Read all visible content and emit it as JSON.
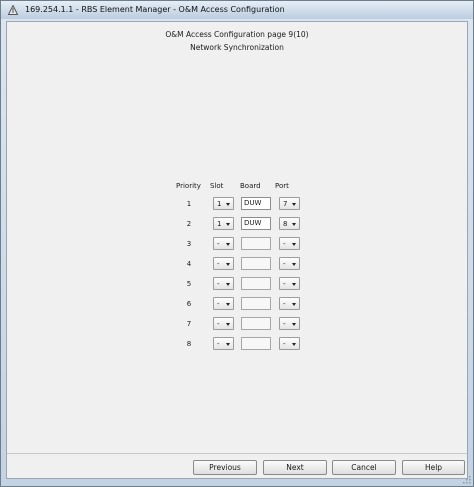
{
  "window": {
    "title": "169.254.1.1 - RBS Element Manager - O&M Access Configuration"
  },
  "page": {
    "heading": "O&M Access Configuration page 9(10)",
    "subheading": "Network Synchronization"
  },
  "table": {
    "headers": {
      "priority": "Priority",
      "slot": "Slot",
      "board": "Board",
      "port": "Port"
    },
    "rows": [
      {
        "priority": "1",
        "slot": "1",
        "board": "DUW",
        "port": "7"
      },
      {
        "priority": "2",
        "slot": "1",
        "board": "DUW",
        "port": "8"
      },
      {
        "priority": "3",
        "slot": "-",
        "board": "",
        "port": "-"
      },
      {
        "priority": "4",
        "slot": "-",
        "board": "",
        "port": "-"
      },
      {
        "priority": "5",
        "slot": "-",
        "board": "",
        "port": "-"
      },
      {
        "priority": "6",
        "slot": "-",
        "board": "",
        "port": "-"
      },
      {
        "priority": "7",
        "slot": "-",
        "board": "",
        "port": "-"
      },
      {
        "priority": "8",
        "slot": "-",
        "board": "",
        "port": "-"
      }
    ]
  },
  "buttons": {
    "previous": "Previous",
    "next": "Next",
    "cancel": "Cancel",
    "help": "Help"
  },
  "icons": {
    "app": "app-triangle-icon",
    "dropdown": "chevron-down-icon",
    "grip": "resize-grip-icon"
  }
}
